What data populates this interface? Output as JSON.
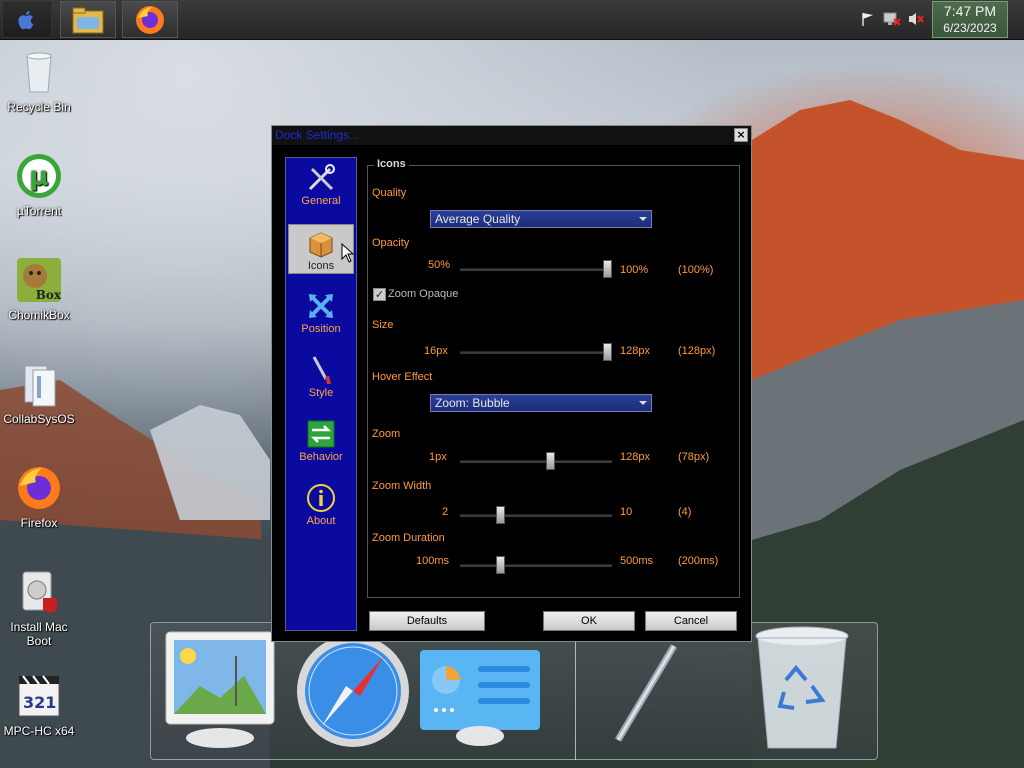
{
  "taskbar": {
    "clock_time": "7:47 PM",
    "clock_date": "6/23/2023"
  },
  "desktop_icons": [
    {
      "label": "Recycle Bin"
    },
    {
      "label": "µTorrent"
    },
    {
      "label": "ChomikBox"
    },
    {
      "label": "CollabSysOS"
    },
    {
      "label": "Firefox"
    },
    {
      "label": "Install Mac Boot"
    },
    {
      "label": "MPC-HC x64"
    }
  ],
  "chomikbox_badge": "Box",
  "mpc_badge": "321",
  "dialog": {
    "title": "Dock Settings...",
    "close_label": "×",
    "sidebar": [
      {
        "label": "General"
      },
      {
        "label": "Icons"
      },
      {
        "label": "Position"
      },
      {
        "label": "Style"
      },
      {
        "label": "Behavior"
      },
      {
        "label": "About"
      }
    ],
    "group_title": "Icons",
    "quality": {
      "label": "Quality",
      "selected": "Average Quality"
    },
    "opacity": {
      "label": "Opacity",
      "min": "50%",
      "max": "100%",
      "current": "(100%)",
      "fraction": 1.0
    },
    "zoom_opaque": {
      "label": "Zoom Opaque",
      "checked": true
    },
    "size": {
      "label": "Size",
      "min": "16px",
      "max": "128px",
      "current": "(128px)",
      "fraction": 1.0
    },
    "hover_effect": {
      "label": "Hover Effect",
      "selected": "Zoom: Bubble"
    },
    "zoom": {
      "label": "Zoom",
      "min": "1px",
      "max": "128px",
      "current": "(78px)",
      "fraction": 0.6
    },
    "zoom_width": {
      "label": "Zoom Width",
      "min": "2",
      "max": "10",
      "current": "(4)",
      "fraction": 0.25
    },
    "zoom_duration": {
      "label": "Zoom Duration",
      "min": "100ms",
      "max": "500ms",
      "current": "(200ms)",
      "fraction": 0.25
    },
    "buttons": {
      "defaults": "Defaults",
      "ok": "OK",
      "cancel": "Cancel"
    }
  },
  "colors": {
    "accent_orange": "#ff9a3c",
    "sidebar_blue": "#0a0aa0",
    "title_blue": "#1c2bd6",
    "clock_green": "#4d6b4d"
  }
}
